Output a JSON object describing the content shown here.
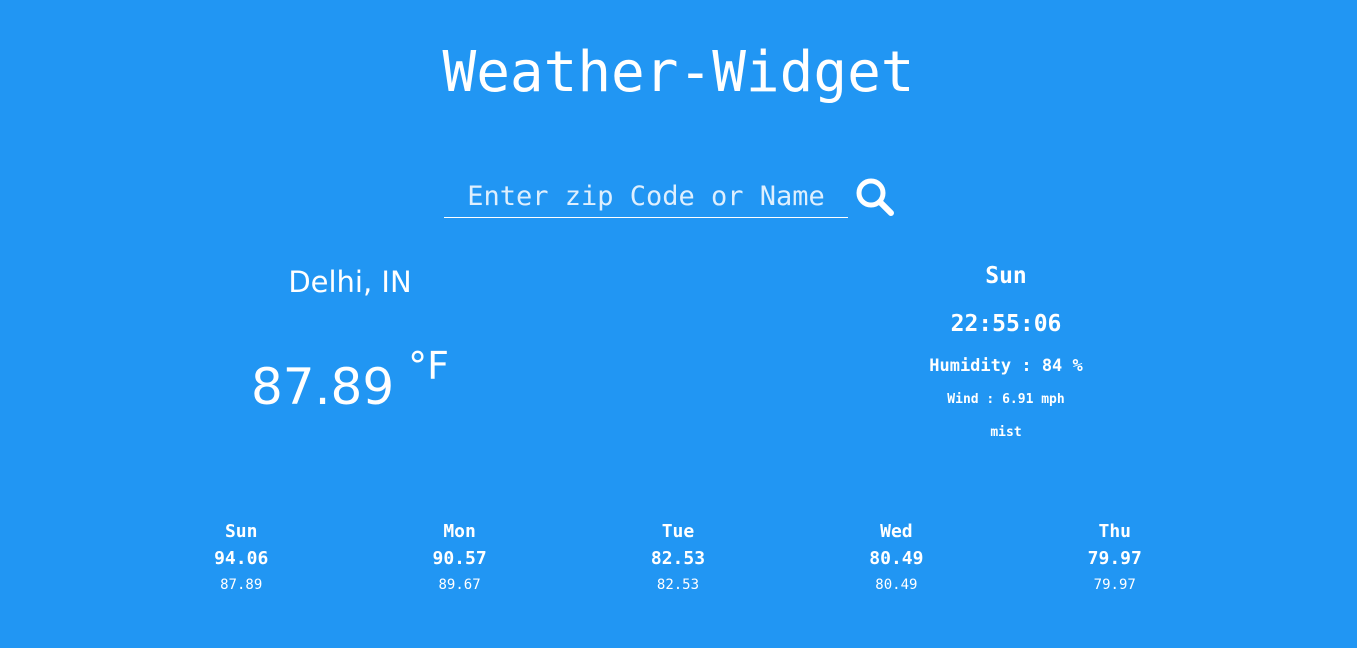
{
  "app": {
    "title": "Weather-Widget"
  },
  "search": {
    "placeholder": "Enter zip Code or Name",
    "value": "",
    "icon": "search-icon"
  },
  "current": {
    "location": "Delhi, IN",
    "temperature": "87.89",
    "unit": "°F",
    "day": "Sun",
    "time": "22:55:06",
    "humidity": "Humidity : 84 %",
    "wind": "Wind : 6.91 mph",
    "description": "mist"
  },
  "forecast": [
    {
      "day": "Sun",
      "max": "94.06",
      "min": "87.89"
    },
    {
      "day": "Mon",
      "max": "90.57",
      "min": "89.67"
    },
    {
      "day": "Tue",
      "max": "82.53",
      "min": "82.53"
    },
    {
      "day": "Wed",
      "max": "80.49",
      "min": "80.49"
    },
    {
      "day": "Thu",
      "max": "79.97",
      "min": "79.97"
    }
  ],
  "colors": {
    "background": "#2196f3",
    "text": "#ffffff"
  }
}
